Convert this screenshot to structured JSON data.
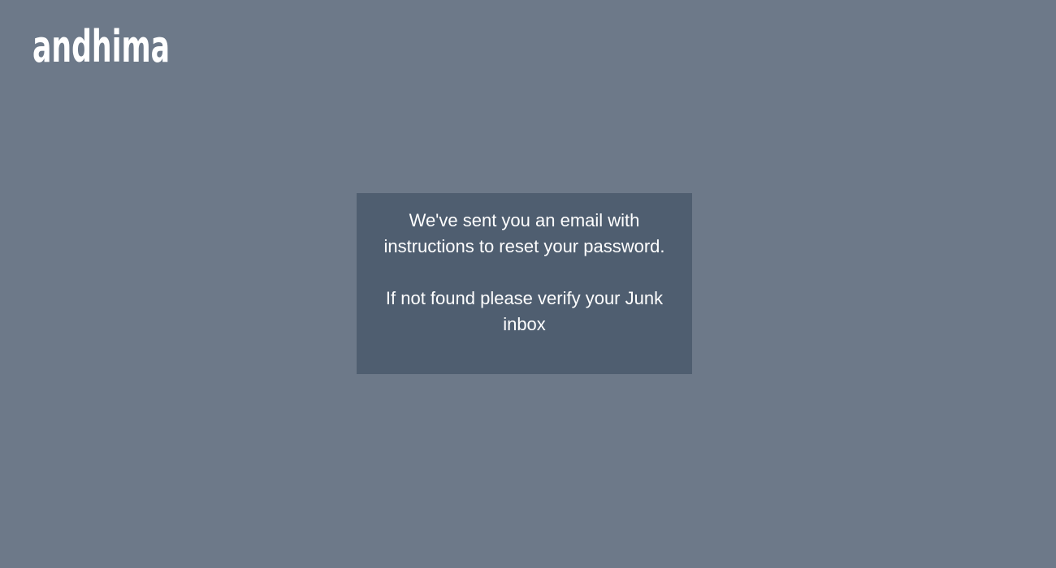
{
  "brand": {
    "logo_text": "andhima",
    "logo_color": "#ffffff"
  },
  "colors": {
    "background": "#6d7989",
    "panel": "#4f5e70",
    "text": "#ffffff"
  },
  "message": {
    "sent_text": "We've sent you an email with instructions to reset your password.",
    "junk_text": "If not found please verify your Junk inbox"
  }
}
